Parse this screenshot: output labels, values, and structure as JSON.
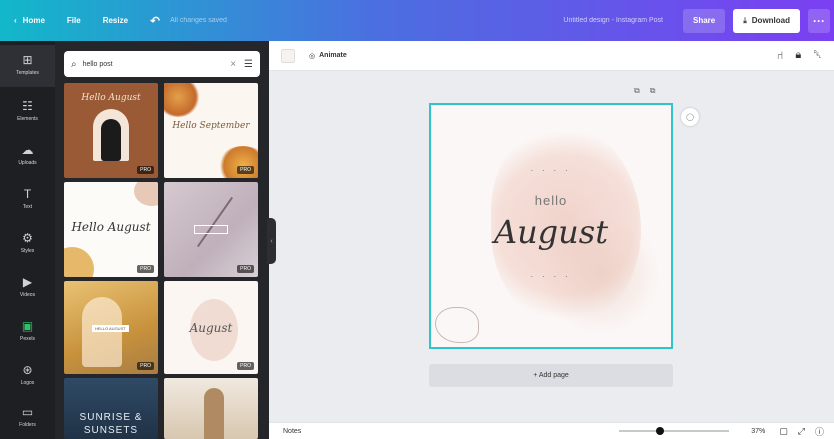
{
  "topbar": {
    "home_label": "Home",
    "file_label": "File",
    "resize_label": "Resize",
    "saved_label": "All changes saved",
    "title": "Untitled design - Instagram Post",
    "share_label": "Share",
    "download_label": "Download",
    "more_label": "···"
  },
  "rail": {
    "items": [
      {
        "label": "Templates",
        "icon": "⊞"
      },
      {
        "label": "Elements",
        "icon": "☷"
      },
      {
        "label": "Uploads",
        "icon": "☁"
      },
      {
        "label": "Text",
        "icon": "T"
      },
      {
        "label": "Styles",
        "icon": "⚙"
      },
      {
        "label": "Videos",
        "icon": "▶"
      },
      {
        "label": "Pexels",
        "icon": "▣"
      },
      {
        "label": "Logos",
        "icon": "⊛"
      },
      {
        "label": "Folders",
        "icon": "▭"
      }
    ]
  },
  "search": {
    "value": "hello post",
    "clear_icon": "×",
    "filter_icon": "☰"
  },
  "templates": {
    "pro_label": "PRO",
    "t1": "Hello August",
    "t2": "Hello September",
    "t3": "Hello August",
    "t5": "HELLO AUGUST",
    "t6": "August",
    "t7_line1": "SUNRISE &",
    "t7_line2": "SUNSETS"
  },
  "editor": {
    "animate_label": "Animate",
    "addpage_label": "+ Add page"
  },
  "design": {
    "hello": "hello",
    "august": "August"
  },
  "bottombar": {
    "notes_label": "Notes",
    "zoom": "37%",
    "zoom_fraction": 0.37
  },
  "colors": {
    "selection": "#2ec4c9",
    "rail_bg": "#1e1f23",
    "panel_bg": "#25262a"
  }
}
